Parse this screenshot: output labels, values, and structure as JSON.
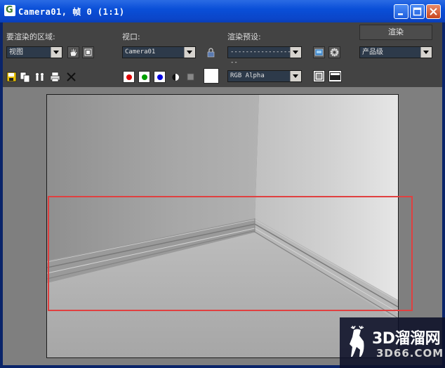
{
  "window": {
    "title": "Camera01, 帧 0 (1:1)",
    "app_icon_letter": "G"
  },
  "controls": {
    "area_label": "要渲染的区域:",
    "area_value": "视图",
    "viewport_label": "视口:",
    "viewport_value": "Camera01",
    "preset_label": "渲染预设:",
    "preset_value": "--------------------",
    "render_label": "渲染",
    "quality_value": "产品级",
    "channel_value": "RGB Alpha"
  },
  "colors": {
    "channel_red": "#e00000",
    "channel_green": "#00a000",
    "channel_blue": "#0000e0",
    "selection_rect": "#e04040"
  },
  "watermark": {
    "line1": "3D溜溜网",
    "line2": "3D66.COM"
  }
}
